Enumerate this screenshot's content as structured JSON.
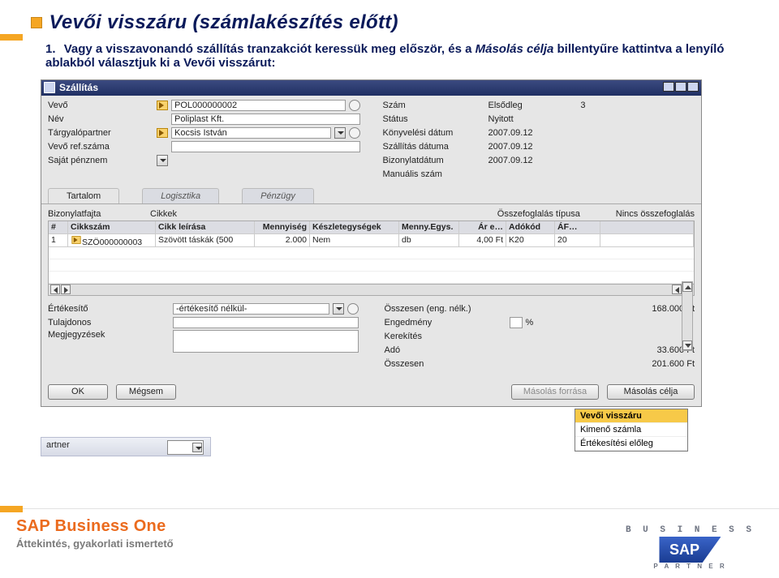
{
  "slide": {
    "title": "Vevői visszáru (számlakészítés előtt)",
    "num": "1.",
    "text_part1": "Vagy a visszavonandó szállítás tranzakciót keressük meg először, és a",
    "italic": "Másolás célja",
    "text_part2": "billentyűre kattintva a lenyíló ablakból választjuk ki a Vevői visszárut:"
  },
  "window": {
    "title": "Szállítás",
    "left_labels": {
      "vevo": "Vevő",
      "nev": "Név",
      "targyalo": "Tárgyalópartner",
      "ref": "Vevő ref.száma",
      "sajat": "Saját pénznem"
    },
    "left_values": {
      "vevo": "POL000000002",
      "nev": "Poliplast Kft.",
      "targyalo": "Kocsis István",
      "ref": ""
    },
    "right_labels": {
      "szam": "Szám",
      "statusz": "Státus",
      "konyv": "Könyvelési dátum",
      "szall": "Szállítás dátuma",
      "biz": "Bizonylatdátum",
      "man": "Manuális szám"
    },
    "right_values": {
      "szam_prefix": "Elsődleg",
      "szam": "3",
      "statusz": "Nyitott",
      "konyv": "2007.09.12",
      "szall": "2007.09.12",
      "biz": "2007.09.12"
    },
    "tabs": [
      "Tartalom",
      "Logisztika",
      "Pénzügy"
    ],
    "mid": {
      "biz_label": "Bizonylatfajta",
      "biz_val": "Cikkek",
      "ossz_label": "Összefoglalás típusa",
      "ossz_val": "Nincs összefoglalás"
    },
    "grid": {
      "head": [
        "#",
        "Cikkszám",
        "Cikk leírása",
        "Mennyiség",
        "Készletegységek",
        "Menny.Egys.",
        "Ár e…",
        "Adókód",
        "ÁF…"
      ],
      "row": [
        "1",
        "SZÖ000000003",
        "Szövött táskák (500",
        "2.000",
        "Nem",
        "db",
        "4,00 Ft",
        "K20",
        "20"
      ]
    },
    "tot_left": {
      "ert_label": "Értékesítő",
      "ert_val": "-értékesítő nélkül-",
      "tul_label": "Tulajdonos",
      "megj_label": "Megjegyzések"
    },
    "tot_right": {
      "ossz_eng": "Összesen (eng. nélk.)",
      "ossz_eng_val": "168.000 Ft",
      "eng": "Engedmény",
      "pct": "%",
      "ker": "Kerekítés",
      "ado": "Adó",
      "ado_val": "33.600 Ft",
      "ossz": "Összesen",
      "ossz_val": "201.600 Ft"
    },
    "buttons": {
      "ok": "OK",
      "cancel": "Mégsem",
      "src": "Másolás forrása",
      "tgt": "Másolás célja"
    },
    "dropdown": {
      "selected": "Vevői visszáru",
      "item2": "Kimenő számla",
      "item3": "Értékesítési előleg"
    },
    "ghost": "artner"
  },
  "footer": {
    "brand": "SAP Business One",
    "sub": "Áttekintés, gyakorlati ismertető",
    "logo_top": "B U S I N E S S",
    "logo_mid": "SAP",
    "logo_bot": "P A R T N E R"
  }
}
